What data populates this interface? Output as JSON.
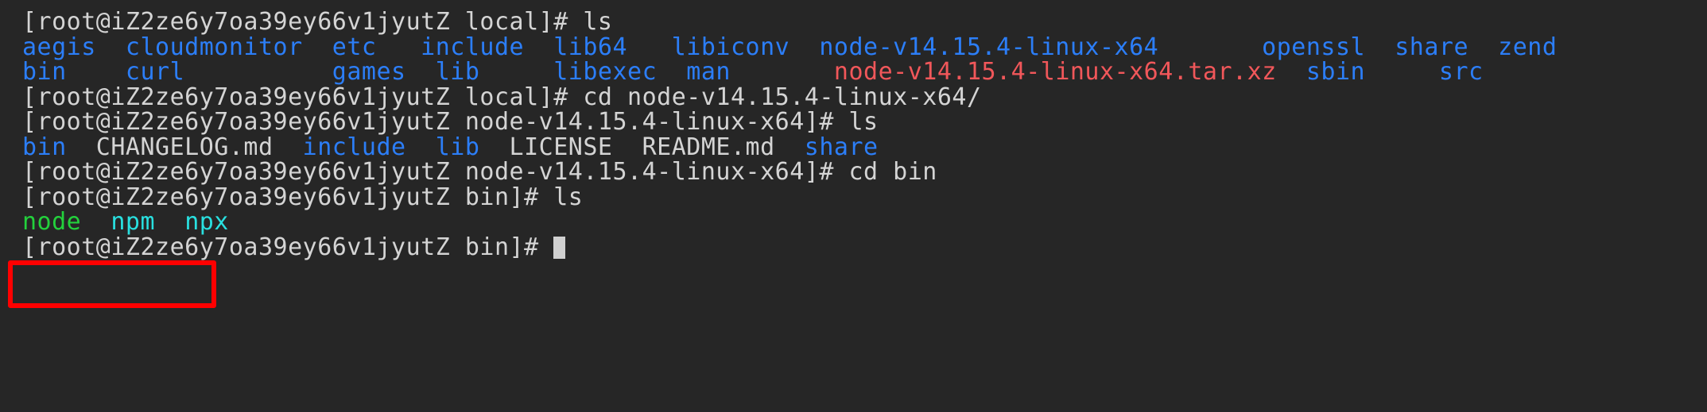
{
  "terminal": {
    "window_title": "Terminal",
    "background_color": "#262626",
    "foreground_color": "#d4d4d4",
    "colors": {
      "directory": "#2c7ef8",
      "archive": "#f1575a",
      "executable": "#23d13c",
      "symlink": "#29e0e0",
      "default_text": "#d4d4d4",
      "highlight_box": "#ff0000",
      "cursor": "#d0d0d0"
    },
    "prompts": {
      "user_host": "[root@iZ2ze6y7oa39ey66v1jyutZ",
      "hostname": "iZ2ze6y7oa39ey66v1jyutZ",
      "user": "root"
    },
    "lines": [
      {
        "id": "line-1-prompt-ls-local",
        "type": "prompt",
        "segments": [
          {
            "text": "[root@iZ2ze6y7oa39ey66v1jyutZ local]# ls",
            "color": "default"
          }
        ]
      },
      {
        "id": "line-2-ls-row-1",
        "type": "output",
        "segments": [
          {
            "text": "aegis  cloudmonitor  etc   include  lib64   libiconv  node-v14.15.4-linux-x64       openssl  share  zend",
            "color": "dir"
          }
        ]
      },
      {
        "id": "line-3-ls-row-2",
        "type": "output",
        "segments": [
          {
            "text": "bin    curl          games  lib     libexec  man       ",
            "color": "dir"
          },
          {
            "text": "node-v14.15.4-linux-x64.tar.xz",
            "color": "archive"
          },
          {
            "text": "  sbin     src",
            "color": "dir"
          }
        ]
      },
      {
        "id": "line-4-prompt-cd-node",
        "type": "prompt",
        "segments": [
          {
            "text": "[root@iZ2ze6y7oa39ey66v1jyutZ local]# cd node-v14.15.4-linux-x64/",
            "color": "default"
          }
        ]
      },
      {
        "id": "line-5-prompt-ls-node",
        "type": "prompt",
        "segments": [
          {
            "text": "[root@iZ2ze6y7oa39ey66v1jyutZ node-v14.15.4-linux-x64]# ls",
            "color": "default"
          }
        ]
      },
      {
        "id": "line-6-ls-node-output",
        "type": "output",
        "segments": [
          {
            "text": "bin",
            "color": "dir"
          },
          {
            "text": "  CHANGELOG.md  ",
            "color": "white"
          },
          {
            "text": "include",
            "color": "dir"
          },
          {
            "text": "  ",
            "color": "white"
          },
          {
            "text": "lib",
            "color": "dir"
          },
          {
            "text": "  LICENSE  README.md  ",
            "color": "white"
          },
          {
            "text": "share",
            "color": "dir"
          }
        ]
      },
      {
        "id": "line-7-prompt-cd-bin",
        "type": "prompt",
        "segments": [
          {
            "text": "[root@iZ2ze6y7oa39ey66v1jyutZ node-v14.15.4-linux-x64]# cd bin",
            "color": "default"
          }
        ]
      },
      {
        "id": "line-8-prompt-ls-bin",
        "type": "prompt",
        "segments": [
          {
            "text": "[root@iZ2ze6y7oa39ey66v1jyutZ bin]# ls",
            "color": "default"
          }
        ]
      },
      {
        "id": "line-9-ls-bin-output",
        "type": "output",
        "segments": [
          {
            "text": "node",
            "color": "exec"
          },
          {
            "text": "  ",
            "color": "white"
          },
          {
            "text": "npm",
            "color": "link"
          },
          {
            "text": "  ",
            "color": "white"
          },
          {
            "text": "npx",
            "color": "link"
          }
        ]
      },
      {
        "id": "line-10-prompt-final",
        "type": "prompt",
        "segments": [
          {
            "text": "[root@iZ2ze6y7oa39ey66v1jyutZ bin]# ",
            "color": "default"
          }
        ],
        "cursor": true
      }
    ],
    "annotation": {
      "type": "rectangle-highlight",
      "color": "#ff0000",
      "target_text": "node  npm  npx"
    }
  }
}
